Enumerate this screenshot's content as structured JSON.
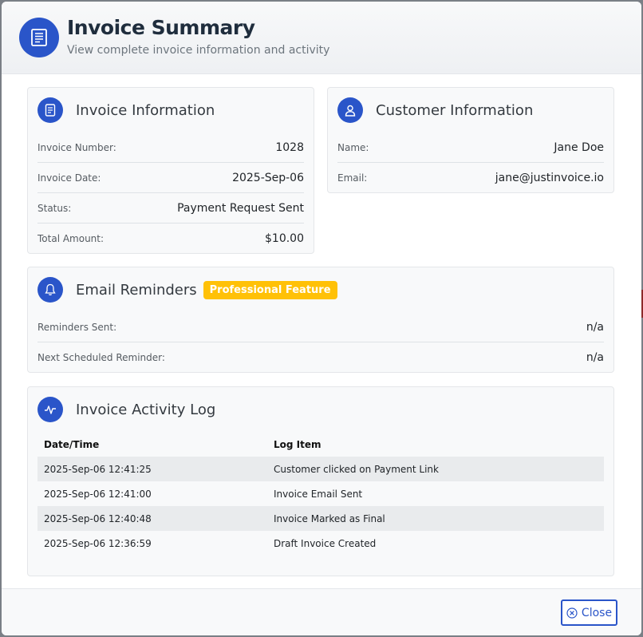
{
  "header": {
    "title": "Invoice Summary",
    "subtitle": "View complete invoice information and activity"
  },
  "invoice_info": {
    "title": "Invoice Information",
    "rows": [
      {
        "label": "Invoice Number:",
        "value": "1028"
      },
      {
        "label": "Invoice Date:",
        "value": "2025-Sep-06"
      },
      {
        "label": "Status:",
        "value": "Payment Request Sent"
      },
      {
        "label": "Total Amount:",
        "value": "$10.00"
      }
    ]
  },
  "customer_info": {
    "title": "Customer Information",
    "rows": [
      {
        "label": "Name:",
        "value": "Jane Doe"
      },
      {
        "label": "Email:",
        "value": "jane@justinvoice.io"
      }
    ]
  },
  "reminders": {
    "title": "Email Reminders",
    "badge": "Professional Feature",
    "rows": [
      {
        "label": "Reminders Sent:",
        "value": "n/a"
      },
      {
        "label": "Next Scheduled Reminder:",
        "value": "n/a"
      }
    ]
  },
  "activity_log": {
    "title": "Invoice Activity Log",
    "columns": [
      "Date/Time",
      "Log Item"
    ],
    "rows": [
      {
        "datetime": "2025-Sep-06 12:41:25",
        "item": "Customer clicked on Payment Link"
      },
      {
        "datetime": "2025-Sep-06 12:41:00",
        "item": "Invoice Email Sent"
      },
      {
        "datetime": "2025-Sep-06 12:40:48",
        "item": "Invoice Marked as Final"
      },
      {
        "datetime": "2025-Sep-06 12:36:59",
        "item": "Draft Invoice Created"
      }
    ]
  },
  "footer": {
    "close_label": "Close"
  },
  "icons": {
    "header": "receipt-icon",
    "invoice": "document-icon",
    "customer": "user-icon",
    "reminders": "bell-icon",
    "activity": "activity-pulse-icon",
    "close": "close-circle-icon"
  },
  "colors": {
    "accent": "#2a55c9",
    "badge": "#ffc107"
  }
}
